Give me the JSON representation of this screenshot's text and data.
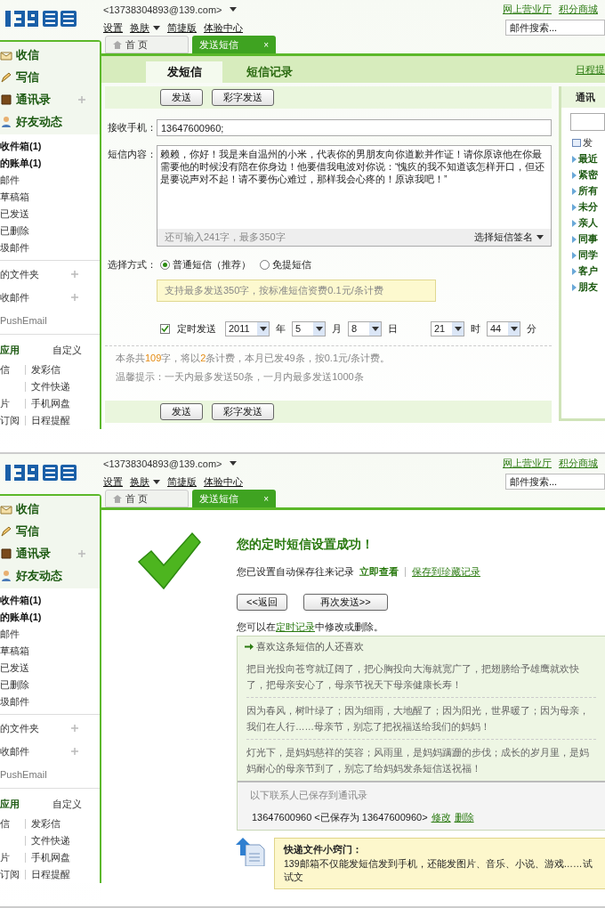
{
  "screens": [
    {
      "kind": "compose",
      "header": {
        "account": "<13738304893@139.com>",
        "links": [
          {
            "label": "设置",
            "kind": "plain"
          },
          {
            "label": "换肤",
            "kind": "menu"
          },
          {
            "label": "简捷版",
            "kind": "plain"
          },
          {
            "label": "体验中心",
            "kind": "plain"
          }
        ],
        "top_links": [
          "网上营业厅",
          "积分商城"
        ],
        "search": {
          "placeholder": "邮件搜索..."
        },
        "tabs": [
          {
            "label": "首 页",
            "kind": "home",
            "selected": false
          },
          {
            "label": "发送短信",
            "kind": "closable",
            "close": "×",
            "selected": true
          }
        ]
      },
      "sidebar": {
        "nav": [
          {
            "label": "收信",
            "kind": "inbox",
            "addable": false
          },
          {
            "label": "写信",
            "kind": "write",
            "addable": false
          },
          {
            "label": "通讯录",
            "kind": "book",
            "addable": true
          },
          {
            "label": "好友动态",
            "kind": "person",
            "addable": false
          }
        ],
        "folders": [
          {
            "label": "收件箱(1)",
            "unread": true
          },
          {
            "label": "的账单(1)",
            "unread": true
          },
          {
            "label": "邮件",
            "unread": false
          },
          {
            "label": "草稿箱",
            "unread": false
          },
          {
            "label": "已发送",
            "unread": false
          },
          {
            "label": "已删除",
            "unread": false
          },
          {
            "label": "圾邮件",
            "unread": false
          }
        ],
        "groups": [
          {
            "label": "的文件夹",
            "addable": true
          },
          {
            "label": "收邮件",
            "addable": true
          },
          {
            "label": "PushEmail",
            "addable": false
          }
        ],
        "apps": {
          "title": "应用",
          "action": "自定义",
          "rows": [
            {
              "left": "信",
              "right": "发彩信"
            },
            {
              "right": "文件快递"
            },
            {
              "left": "片",
              "right": "手机网盘"
            },
            {
              "left": "订阅",
              "right": "日程提醒"
            }
          ]
        }
      },
      "compose": {
        "subtabs": [
          {
            "label": "发短信",
            "selected": true
          },
          {
            "label": "短信记录",
            "selected": false
          }
        ],
        "corner_link": "日程提",
        "buttons": [
          "发送",
          "彩字发送"
        ],
        "receiver": {
          "label": "接收手机：",
          "value": "13647600960;"
        },
        "content": {
          "label": "短信内容：",
          "value": "赖赖，你好！我是来自温州的小米，代表你的男朋友向你道歉并作证！请你原谅他在你最需要他的时候没有陪在你身边！他要借我电波对你说：“愧疚的我不知道该怎样开口，但还是要说声对不起！请不要伤心难过，那样我会心疼的！原谅我吧！”",
          "counter": "还可输入241字，最多350字",
          "signature": "选择短信签名"
        },
        "mode": {
          "label": "选择方式：",
          "options": [
            {
              "label": "普通短信（推荐）",
              "selected": true
            },
            {
              "label": "免提短信",
              "selected": false
            }
          ],
          "tip": "支持最多发送350字，按标准短信资费0.1元/条计费"
        },
        "schedule": {
          "label": "定时发送",
          "checked": true,
          "fields": [
            {
              "value": "2011",
              "unit": "年"
            },
            {
              "value": "5",
              "unit": "月"
            },
            {
              "value": "8",
              "unit": "日"
            },
            {
              "value": "21",
              "unit": "时"
            },
            {
              "value": "44",
              "unit": "分"
            }
          ]
        },
        "summary": "本条共**109**字，将以**2**条计费，本月已发49条，按0.1元/条计费。",
        "notice": "温馨提示：一天内最多发送50条，一月内最多发送1000条",
        "bottom_buttons": [
          "发送",
          "彩字发送"
        ],
        "address_book": {
          "title": "通讯",
          "items": [
            {
              "label": "发",
              "kind": "card"
            },
            {
              "label": "最近",
              "kind": "group"
            },
            {
              "label": "紧密",
              "kind": "group"
            },
            {
              "label": "所有",
              "kind": "group"
            },
            {
              "label": "未分",
              "kind": "group"
            },
            {
              "label": "亲人",
              "kind": "group"
            },
            {
              "label": "同事",
              "kind": "group"
            },
            {
              "label": "同学",
              "kind": "group"
            },
            {
              "label": "客户",
              "kind": "group"
            },
            {
              "label": "朋友",
              "kind": "group"
            }
          ]
        }
      }
    },
    {
      "kind": "success",
      "header": {
        "account": "<13738304893@139.com>",
        "links": [
          {
            "label": "设置",
            "kind": "plain"
          },
          {
            "label": "换肤",
            "kind": "menu"
          },
          {
            "label": "简捷版",
            "kind": "plain"
          },
          {
            "label": "体验中心",
            "kind": "plain"
          }
        ],
        "top_links": [
          "网上营业厅",
          "积分商城"
        ],
        "search": {
          "placeholder": "邮件搜索..."
        },
        "tabs": [
          {
            "label": "首 页",
            "kind": "home",
            "selected": false
          },
          {
            "label": "发送短信",
            "kind": "closable",
            "close": "×",
            "selected": true
          }
        ]
      },
      "sidebar": {
        "nav": [
          {
            "label": "收信",
            "kind": "inbox",
            "addable": false
          },
          {
            "label": "写信",
            "kind": "write",
            "addable": false
          },
          {
            "label": "通讯录",
            "kind": "book",
            "addable": true
          },
          {
            "label": "好友动态",
            "kind": "person",
            "addable": false
          }
        ],
        "folders": [
          {
            "label": "收件箱(1)",
            "unread": true
          },
          {
            "label": "的账单(1)",
            "unread": true
          },
          {
            "label": "邮件",
            "unread": false
          },
          {
            "label": "草稿箱",
            "unread": false
          },
          {
            "label": "已发送",
            "unread": false
          },
          {
            "label": "已删除",
            "unread": false
          },
          {
            "label": "圾邮件",
            "unread": false
          }
        ],
        "groups": [
          {
            "label": "的文件夹",
            "addable": true
          },
          {
            "label": "收邮件",
            "addable": true
          },
          {
            "label": "PushEmail",
            "addable": false
          }
        ],
        "apps": {
          "title": "应用",
          "action": "自定义",
          "rows": [
            {
              "left": "信",
              "right": "发彩信"
            },
            {
              "right": "文件快递"
            },
            {
              "left": "片",
              "right": "手机网盘"
            },
            {
              "left": "订阅",
              "right": "日程提醒"
            }
          ]
        }
      },
      "success": {
        "title": "您的定时短信设置成功！",
        "saved_text": "您已设置自动保存往来记录",
        "view_link": "立即查看",
        "save_link": "保存到珍藏记录",
        "buttons": [
          "<<返回",
          "再次发送>>"
        ],
        "edit_note": {
          "before": "您可以在",
          "link": "定时记录",
          "after": "中修改或删除。"
        },
        "suggest": {
          "title": "喜欢这条短信的人还喜欢",
          "items": [
            "把目光投向苍穹就辽阔了，把心胸投向大海就宽广了，把翅膀给予雄鹰就欢快了，把母亲安心了，母亲节祝天下母亲健康长寿！",
            "因为春风，树叶绿了；因为细雨，大地醒了；因为阳光，世界暖了；因为母亲，我们在人行……母亲节，别忘了把祝福送给我们的妈妈！",
            "灯光下，是妈妈慈祥的笑容；风雨里，是妈妈蹒跚的步伐；成长的岁月里，是妈妈耐心的母亲节到了，别忘了给妈妈发条短信送祝福！"
          ]
        },
        "contacts": {
          "title": "以下联系人已保存到通讯录",
          "entry": "13647600960 <已保存为 13647600960>",
          "edit": "修改",
          "delete": "删除"
        },
        "tip": {
          "title": "快递文件小窍门：",
          "text": "139邮箱不仅能发短信发到手机，还能发图片、音乐、小说、游戏……试试文"
        }
      }
    }
  ]
}
